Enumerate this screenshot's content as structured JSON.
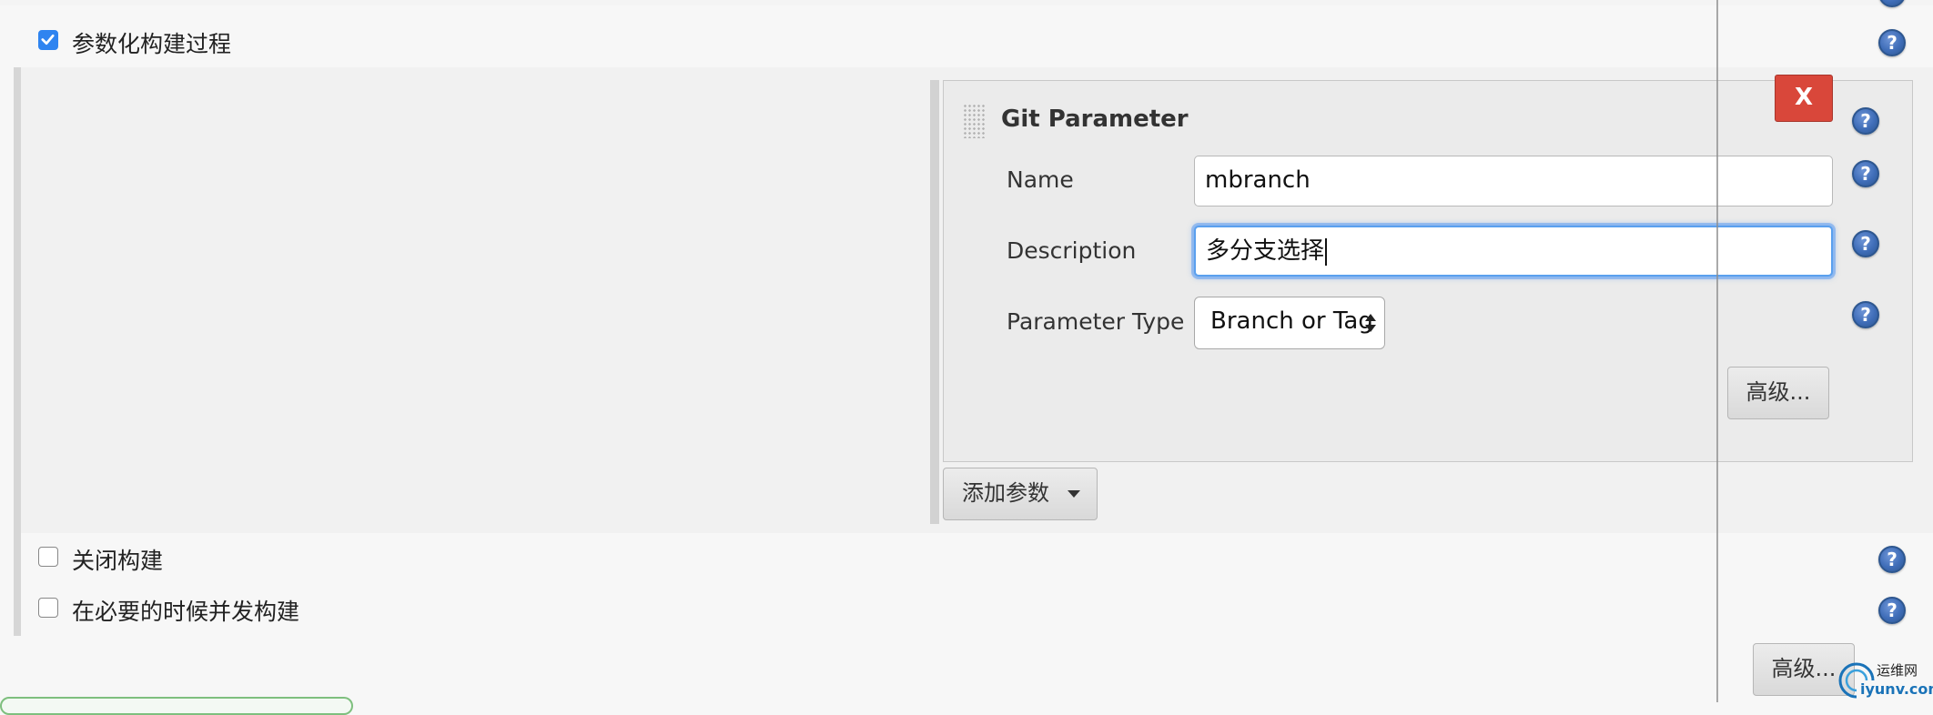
{
  "options": {
    "parameterized": {
      "label": "参数化构建过程",
      "checked": true
    },
    "disable_build": {
      "label": "关闭构建",
      "checked": false
    },
    "concurrent_build": {
      "label": "在必要的时候并发构建",
      "checked": false
    }
  },
  "git_parameter": {
    "title": "Git Parameter",
    "delete_label": "X",
    "fields": {
      "name": {
        "label": "Name",
        "value": "mbranch"
      },
      "description": {
        "label": "Description",
        "value": "多分支选择"
      },
      "parameter_type": {
        "label": "Parameter Type",
        "value": "Branch or Tag"
      }
    },
    "advanced_label": "高级..."
  },
  "add_parameter_label": "添加参数",
  "bottom_advanced_label": "高级...",
  "help_glyph": "?",
  "watermark": {
    "cn": "运维网",
    "en": "iyunv.com"
  },
  "colors": {
    "accent_blue": "#2f84f0",
    "delete_red": "#d9473a",
    "help_blue": "#3f6db8"
  }
}
